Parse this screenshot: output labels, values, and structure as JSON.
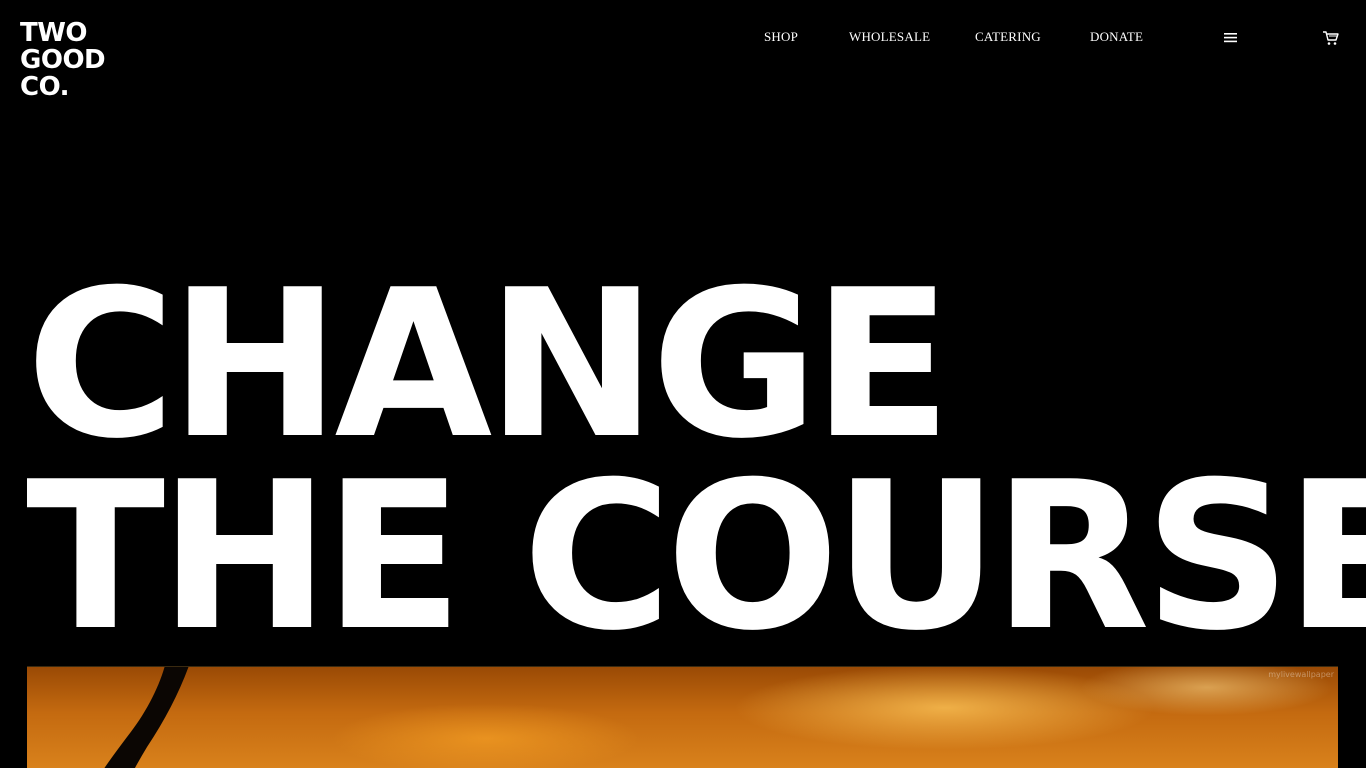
{
  "brand": {
    "logo_lines": [
      "TWO",
      "GOOD",
      "CO."
    ]
  },
  "nav": {
    "items": [
      {
        "label": "SHOP"
      },
      {
        "label": "WHOLESALE"
      },
      {
        "label": "CATERING"
      },
      {
        "label": "DONATE"
      }
    ],
    "menu_icon": "hamburger-menu-icon",
    "cart_icon": "shopping-cart-icon"
  },
  "hero": {
    "title_lines": [
      "CHANGE",
      "THE COURSE"
    ],
    "image_watermark": "mylivewallpaper"
  },
  "colors": {
    "background": "#000000",
    "text": "#ffffff",
    "sunset": "#c46a10"
  }
}
